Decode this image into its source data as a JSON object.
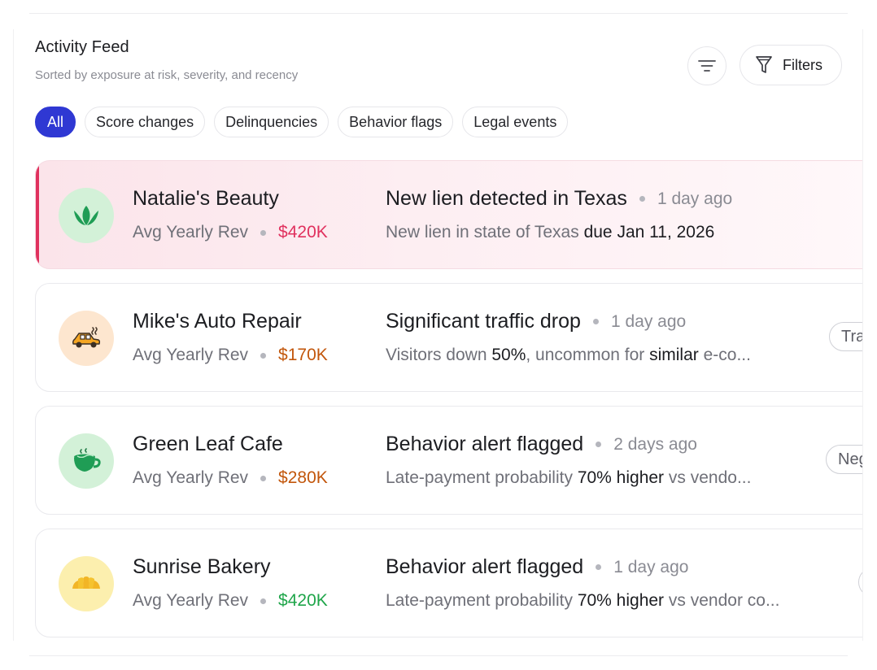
{
  "header": {
    "title": "Activity Feed",
    "subtitle": "Sorted by exposure at risk, severity, and recency",
    "filters_label": "Filters"
  },
  "chips": [
    {
      "label": "All",
      "active": true
    },
    {
      "label": "Score changes",
      "active": false
    },
    {
      "label": "Delinquencies",
      "active": false
    },
    {
      "label": "Behavior flags",
      "active": false
    },
    {
      "label": "Legal events",
      "active": false
    }
  ],
  "feed": [
    {
      "business": "Natalie's Beauty",
      "rev_label": "Avg Yearly Rev",
      "rev_value": "$420K",
      "rev_color": "#e0315e",
      "event_title": "New lien detected in Texas",
      "event_time": "1 day ago",
      "desc_parts": [
        "New lien in state of Texas ",
        "due Jan 11, 2026"
      ],
      "icon": "lotus-icon",
      "avatar_bg": "#d3f1d8",
      "tag": ""
    },
    {
      "business": "Mike's Auto Repair",
      "rev_label": "Avg Yearly Rev",
      "rev_value": "$170K",
      "rev_color": "#c2560b",
      "event_title": "Significant traffic drop",
      "event_time": "1 day ago",
      "desc_parts": [
        "Visitors down ",
        "50%",
        ", uncommon for ",
        "similar",
        " e-co..."
      ],
      "icon": "car-icon",
      "avatar_bg": "#fde6cf",
      "tag": "Tra"
    },
    {
      "business": "Green Leaf Cafe",
      "rev_label": "Avg Yearly Rev",
      "rev_value": "$280K",
      "rev_color": "#c2560b",
      "event_title": "Behavior alert flagged",
      "event_time": "2 days ago",
      "desc_parts": [
        "Late-payment probability ",
        "70% higher",
        " vs vendo..."
      ],
      "icon": "coffee-cup-icon",
      "avatar_bg": "#d3f1d8",
      "tag": "Neg"
    },
    {
      "business": "Sunrise Bakery",
      "rev_label": "Avg Yearly Rev",
      "rev_value": "$420K",
      "rev_color": "#1fa54a",
      "event_title": "Behavior alert flagged",
      "event_time": "1 day ago",
      "desc_parts": [
        "Late-payment probability ",
        "70% higher",
        " vs vendor co..."
      ],
      "icon": "croissant-icon",
      "avatar_bg": "#fcefae",
      "tag": ""
    }
  ]
}
